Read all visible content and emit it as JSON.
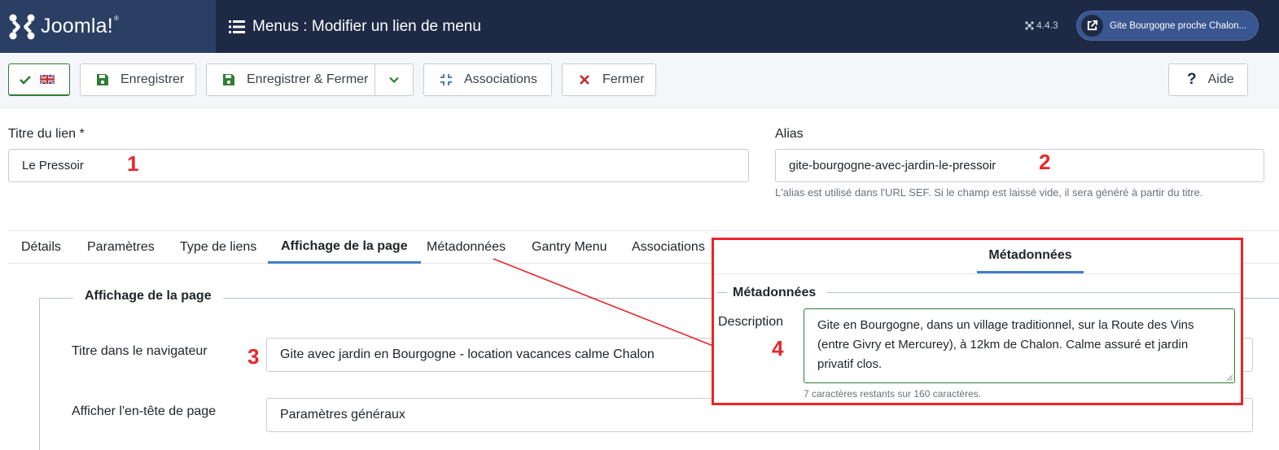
{
  "header": {
    "logo_text": "Joomla!",
    "logo_reg": "®",
    "page_title": "Menus : Modifier un lien de menu",
    "version": "4.4.3",
    "site_button_label": "Gite Bourgogne proche Chalon..."
  },
  "toolbar": {
    "save_label": "Enregistrer",
    "save_close_label": "Enregistrer & Fermer",
    "associations_label": "Associations",
    "close_label": "Fermer",
    "help_label": "Aide",
    "help_symbol": "?"
  },
  "form": {
    "title_label": "Titre du lien *",
    "title_value": "Le Pressoir",
    "alias_label": "Alias",
    "alias_value": "gite-bourgogne-avec-jardin-le-pressoir",
    "alias_hint": "L'alias est utilisé dans l'URL SEF. Si le champ est laissé vide, il sera généré à partir du titre."
  },
  "tabs": [
    {
      "label": "Détails"
    },
    {
      "label": "Paramètres"
    },
    {
      "label": "Type de liens"
    },
    {
      "label": "Affichage de la page"
    },
    {
      "label": "Métadonnées"
    },
    {
      "label": "Gantry Menu"
    },
    {
      "label": "Associations"
    }
  ],
  "page_display": {
    "legend": "Affichage de la page",
    "browser_title_label": "Titre dans le navigateur",
    "browser_title_value": "Gite avec jardin en Bourgogne - location vacances calme Chalon",
    "show_header_label": "Afficher l'en-tête de page",
    "show_header_value": "Paramètres généraux"
  },
  "callout": {
    "tab_label": "Métadonnées",
    "legend": "Métadonnées",
    "description_label": "Description",
    "description_value": "Gite en Bourgogne, dans un village traditionnel, sur la Route des Vins (entre Givry et Mercurey), à 12km de Chalon. Calme assuré et jardin privatif clos.",
    "char_count": "7 caractères restants sur 160 caractères."
  },
  "annotations": {
    "n1": "1",
    "n2": "2",
    "n3": "3",
    "n4": "4"
  },
  "colors": {
    "header_bg": "#1e2a45",
    "logo_bg": "#2a3f63",
    "accent_green": "#2f7d32",
    "accent_red": "#c8272c",
    "tab_active": "#457dc4",
    "annotation_red": "#e8262a"
  }
}
